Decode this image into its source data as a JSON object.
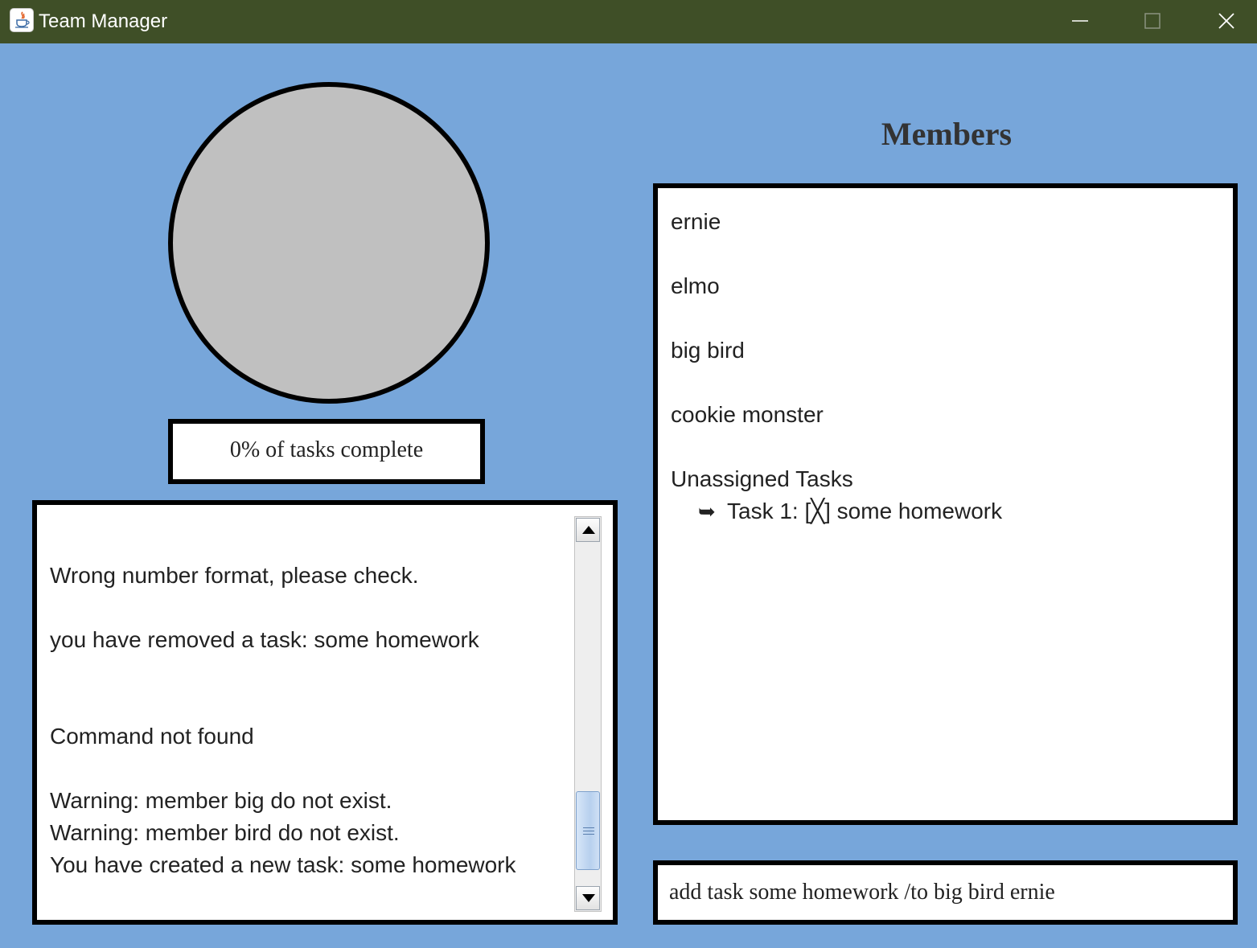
{
  "window": {
    "title": "Team Manager",
    "icon": "java-cup-icon"
  },
  "progress": {
    "percent_complete": 0,
    "label": "0% of tasks complete",
    "circle_color": "#c0c0c0"
  },
  "log": {
    "lines": [
      "",
      "Wrong number format, please check.",
      "",
      "you have removed a task: some homework",
      "",
      "",
      "Command not found",
      "",
      "Warning: member big do not exist.",
      "Warning: member bird do not exist.",
      "You have created a new task: some homework"
    ]
  },
  "members": {
    "heading": "Members",
    "items": [
      "ernie",
      "elmo",
      "big bird",
      "cookie monster"
    ],
    "unassigned": {
      "heading": "Unassigned Tasks",
      "tasks": [
        {
          "arrow": "➥",
          "text": "Task 1: [╳] some homework"
        }
      ]
    }
  },
  "command": {
    "value": "add task some homework /to big bird ernie"
  },
  "colors": {
    "background": "#77a6da",
    "titlebar": "#3f4f27",
    "border": "#000000",
    "panel": "#ffffff"
  }
}
